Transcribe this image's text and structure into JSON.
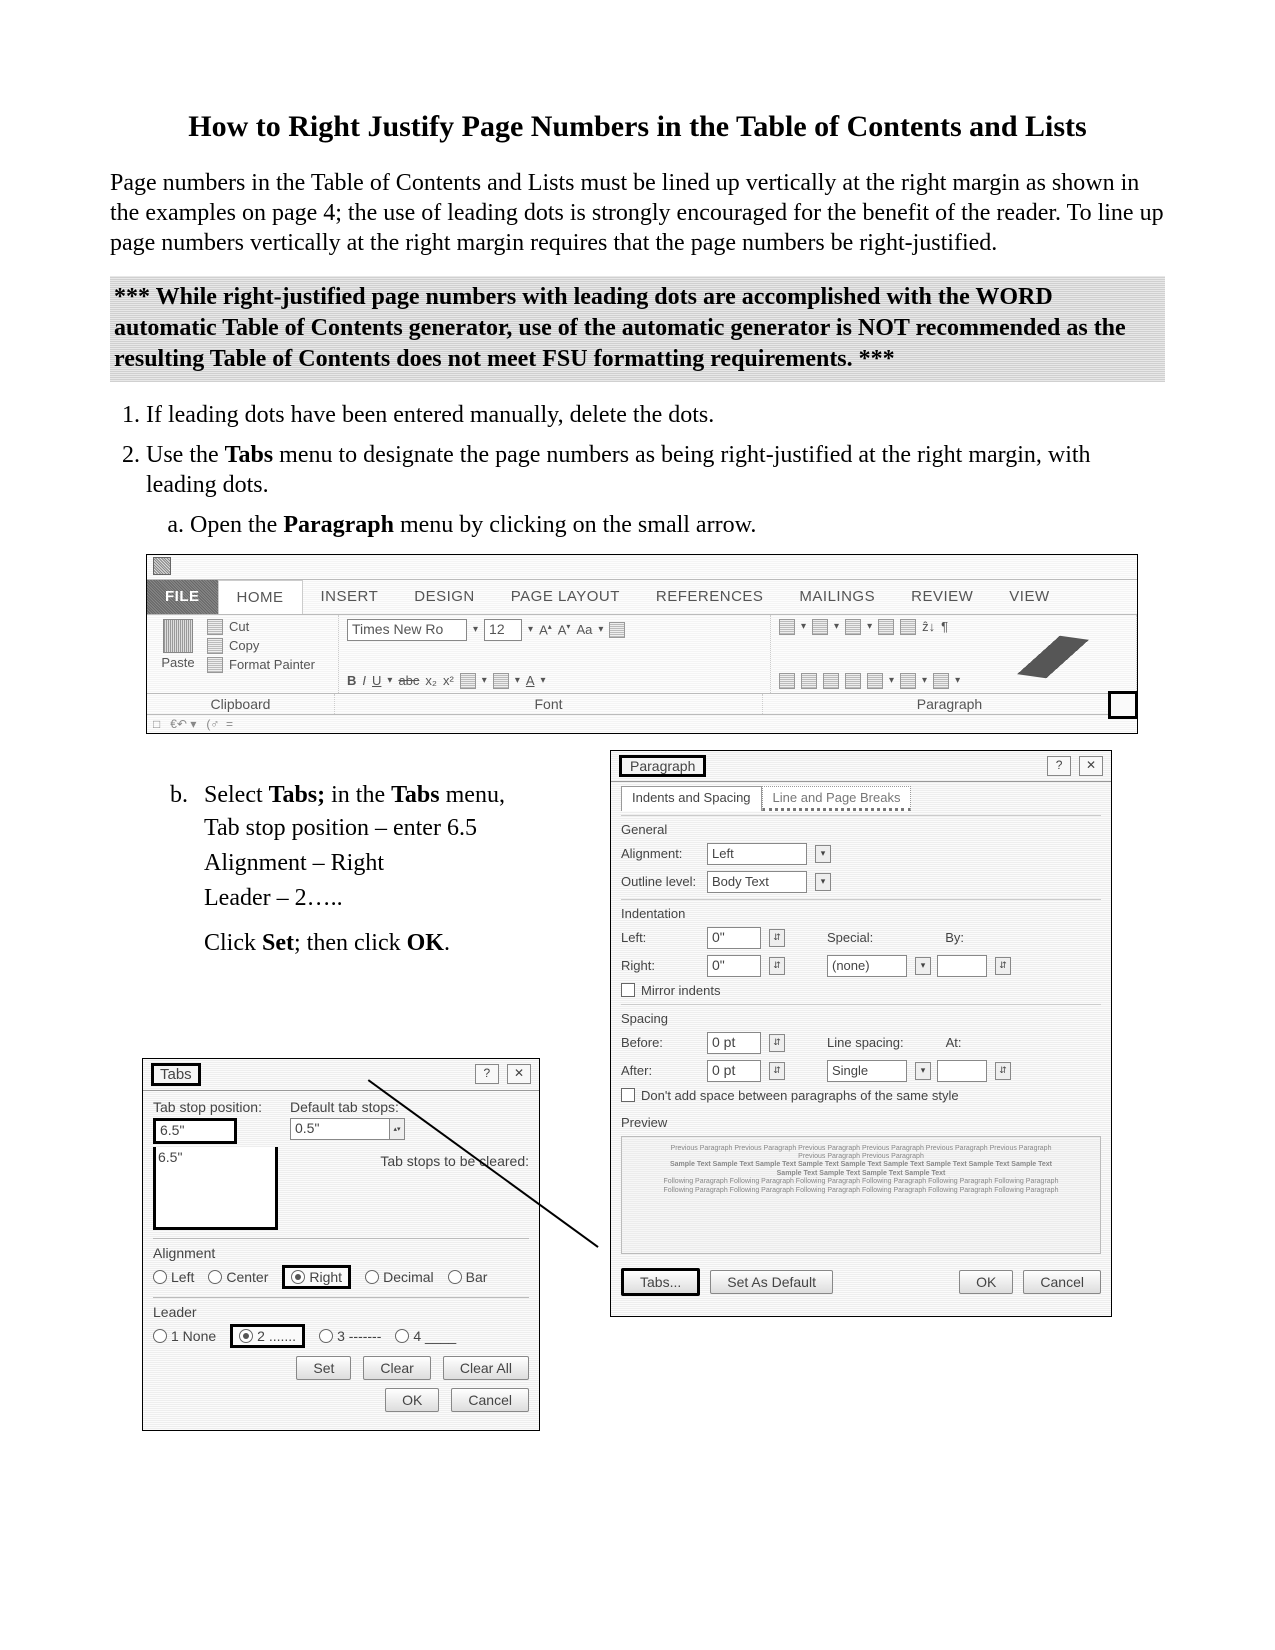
{
  "title": "How to Right Justify Page Numbers in the Table of Contents and Lists",
  "intro": "Page numbers in the Table of Contents and Lists must be lined up vertically at the right margin as shown in the examples on page 4; the use of leading dots is strongly encouraged for the benefit of the reader. To line up page numbers vertically at the right margin requires that the page numbers be right-justified.",
  "warning": "*** While right-justified page numbers with leading dots are accomplished with the WORD automatic Table of Contents generator, use of the automatic generator is NOT recommended as the resulting Table of Contents does not meet FSU formatting requirements. ***",
  "steps": {
    "s1": "If leading dots have been entered manually, delete the dots.",
    "s2_pre": "Use the ",
    "s2_bold": "Tabs",
    "s2_post": " menu to designate the page numbers as being right-justified at the right margin, with leading dots.",
    "s2a_pre": "Open the ",
    "s2a_bold": "Paragraph",
    "s2a_post": " menu by clicking on the small arrow.",
    "s2b_pre": "Select ",
    "s2b_bold1": "Tabs;",
    "s2b_mid": " in the ",
    "s2b_bold2": "Tabs",
    "s2b_post": " menu,",
    "s2b_l1": "Tab stop position – enter 6.5",
    "s2b_l2": "Alignment – Right",
    "s2b_l3": "Leader – 2…..",
    "s2b_l4_pre": "Click ",
    "s2b_l4_b1": "Set",
    "s2b_l4_mid": "; then click ",
    "s2b_l4_b2": "OK",
    "s2b_l4_post": "."
  },
  "ribbon": {
    "tabs": {
      "file": "FILE",
      "home": "HOME",
      "insert": "INSERT",
      "design": "DESIGN",
      "page_layout": "PAGE LAYOUT",
      "references": "REFERENCES",
      "mailings": "MAILINGS",
      "review": "REVIEW",
      "view": "VIEW"
    },
    "clipboard": {
      "paste": "Paste",
      "cut": "Cut",
      "copy": "Copy",
      "format_painter": "Format Painter",
      "label": "Clipboard"
    },
    "font": {
      "name": "Times New Ro",
      "size": "12",
      "b": "B",
      "i": "I",
      "u": "U",
      "abc": "abc",
      "x2": "x₂",
      "x2sup": "x²",
      "aa": "Aa",
      "label": "Font"
    },
    "paragraph": {
      "label": "Paragraph"
    }
  },
  "tabs_dlg": {
    "title": "Tabs",
    "tab_stop_label": "Tab stop position:",
    "tab_stop_value": "6.5\"",
    "list_value": "6.5\"",
    "default_label": "Default tab stops:",
    "default_value": "0.5\"",
    "cleared_label": "Tab stops to be cleared:",
    "alignment": {
      "title": "Alignment",
      "left": "Left",
      "center": "Center",
      "right": "Right",
      "decimal": "Decimal",
      "bar": "Bar"
    },
    "leader": {
      "title": "Leader",
      "n1": "1 None",
      "n2": "2 .......",
      "n3": "3 -------",
      "n4": "4 ____"
    },
    "buttons": {
      "set": "Set",
      "clear": "Clear",
      "clear_all": "Clear All",
      "ok": "OK",
      "cancel": "Cancel"
    }
  },
  "para_dlg": {
    "title": "Paragraph",
    "tab1": "Indents and Spacing",
    "tab2": "Line and Page Breaks",
    "general": {
      "title": "General",
      "alignment_l": "Alignment:",
      "alignment_v": "Left",
      "outline_l": "Outline level:",
      "outline_v": "Body Text"
    },
    "indent": {
      "title": "Indentation",
      "left_l": "Left:",
      "left_v": "0\"",
      "right_l": "Right:",
      "right_v": "0\"",
      "special_l": "Special:",
      "special_v": "(none)",
      "by_l": "By:",
      "mirror": "Mirror indents"
    },
    "spacing": {
      "title": "Spacing",
      "before_l": "Before:",
      "before_v": "0 pt",
      "after_l": "After:",
      "after_v": "0 pt",
      "line_l": "Line spacing:",
      "line_v": "Single",
      "at_l": "At:",
      "nospace": "Don't add space between paragraphs of the same style"
    },
    "preview": {
      "title": "Preview"
    },
    "buttons": {
      "tabs": "Tabs...",
      "default": "Set As Default",
      "ok": "OK",
      "cancel": "Cancel"
    }
  }
}
